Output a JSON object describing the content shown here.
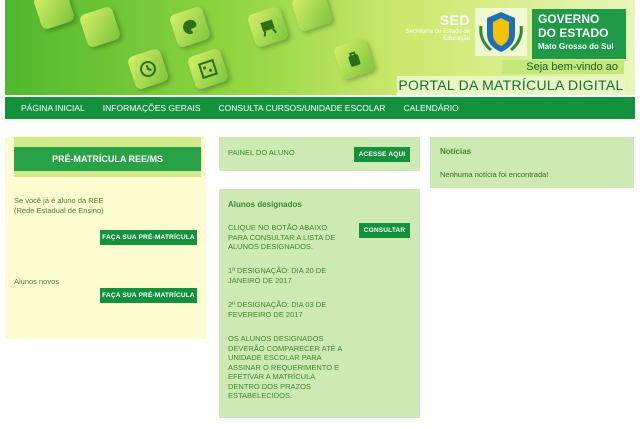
{
  "header": {
    "sed_title": "SED",
    "sed_subtitle": "Secretaria de Estado de Educação",
    "gov_line1": "GOVERNO",
    "gov_line2": "DO ESTADO",
    "gov_state": "Mato Grosso do Sul",
    "welcome": "Seja bem-vindo ao",
    "portal_title": "PORTAL DA MATRÍCULA DIGITAL"
  },
  "nav": {
    "items": [
      {
        "label": "PÁGINA INICIAL"
      },
      {
        "label": "INFORMAÇÕES GERAIS"
      },
      {
        "label": "CONSULTA CURSOS/UNIDADE ESCOLAR"
      },
      {
        "label": "CALENDÁRIO"
      }
    ]
  },
  "pre_matricula": {
    "title": "PRÉ-MATRÍCULA REE/MS",
    "aluno_text": "Se você já é aluno da REE (Rede Estadual de Ensino)",
    "aluno_button": "FAÇA SUA PRÉ-MATRÍCULA",
    "novos_text": "Alunos novos",
    "novos_button": "FAÇA SUA PRÉ-MATRÍCULA"
  },
  "painel": {
    "label": "PAINEL DO ALUNO",
    "button": "ACESSE AQUI"
  },
  "designados": {
    "title": "Alunos designados",
    "instructions": "CLIQUE NO BOTÃO ABAIXO PARA CONSULTAR A LISTA DE ALUNOS DESIGNADOS.",
    "button": "CONSULTAR",
    "first": "1ª DESIGNAÇÃO: DIA 20 DE JANEIRO DE 2017",
    "second": "2ª DESIGNAÇÃO: DIA 03 DE FEVEREIRO DE 2017",
    "notice": "OS ALUNOS DESIGNADOS DEVERÃO COMPARECER ATÉ A UNIDADE ESCOLAR PARA ASSINAR O REQUERIMENTO E EFETIVAR A MATRÍCULA DENTRO DOS PRAZOS ESTABELECIDOS."
  },
  "noticias": {
    "title": "Notícias",
    "empty": "Nenhuma notícia foi encontrada!"
  },
  "colors": {
    "brand_green": "#14913d",
    "panel_green": "#cdeab4",
    "panel_yellow": "#fdfbd0",
    "text_green": "#3a8a2a"
  },
  "icons": [
    "clock-icon",
    "palette-icon",
    "abacus-icon",
    "art-easel-icon",
    "backpack-icon",
    "state-crest-icon"
  ]
}
